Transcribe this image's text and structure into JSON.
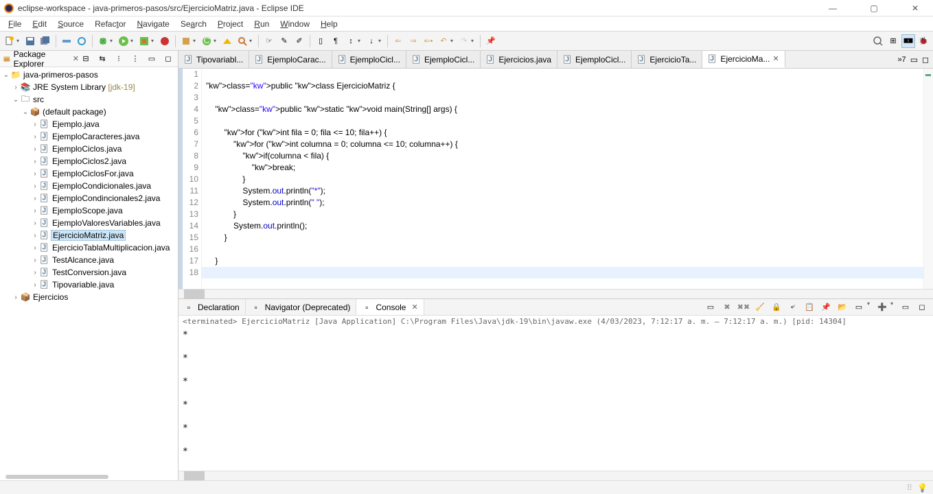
{
  "titlebar": {
    "text": "eclipse-workspace - java-primeros-pasos/src/EjercicioMatriz.java - Eclipse IDE"
  },
  "menu": [
    "File",
    "Edit",
    "Source",
    "Refactor",
    "Navigate",
    "Search",
    "Project",
    "Run",
    "Window",
    "Help"
  ],
  "package_explorer": {
    "title": "Package Explorer",
    "project": "java-primeros-pasos",
    "jre": "JRE System Library",
    "jre_ver": "[jdk-19]",
    "src": "src",
    "pkg": "(default package)",
    "files": [
      "Ejemplo.java",
      "EjemploCaracteres.java",
      "EjemploCiclos.java",
      "EjemploCiclos2.java",
      "EjemploCiclosFor.java",
      "EjemploCondicionales.java",
      "EjemploCondincionales2.java",
      "EjemploScope.java",
      "EjemploValoresVariables.java",
      "EjercicioMatriz.java",
      "EjercicioTablaMultiplicacion.java",
      "TestAlcance.java",
      "TestConversion.java",
      "Tipovariable.java"
    ],
    "selected_index": 9,
    "other_proj": "Ejercicios"
  },
  "editor_tabs": [
    {
      "label": "Tipovariabl...",
      "active": false
    },
    {
      "label": "EjemploCarac...",
      "active": false
    },
    {
      "label": "EjemploCicl...",
      "active": false
    },
    {
      "label": "EjemploCicl...",
      "active": false
    },
    {
      "label": "Ejercicios.java",
      "active": false
    },
    {
      "label": "EjemploCicl...",
      "active": false
    },
    {
      "label": "EjercicioTa...",
      "active": false
    },
    {
      "label": "EjercicioMa...",
      "active": true
    }
  ],
  "tabs_overflow": "»7",
  "code": {
    "lines": [
      "",
      "public class EjercicioMatriz {",
      "",
      "    public static void main(String[] args) {",
      "",
      "        for (int fila = 0; fila <= 10; fila++) {",
      "            for (int columna = 0; columna <= 10; columna++) {",
      "                if(columna < fila) {",
      "                    break;",
      "                }",
      "                System.out.println(\"*\");",
      "                System.out.println(\" \");",
      "            }",
      "            System.out.println();",
      "        }",
      "",
      "    }",
      "}"
    ],
    "highlight_line": 18
  },
  "bottom": {
    "tabs": [
      {
        "label": "Declaration"
      },
      {
        "label": "Navigator (Deprecated)"
      },
      {
        "label": "Console",
        "active": true
      }
    ],
    "status": "<terminated> EjercicioMatriz [Java Application] C:\\Program Files\\Java\\jdk-19\\bin\\javaw.exe (4/03/2023, 7:12:17 a. m. – 7:12:17 a. m.) [pid: 14304]",
    "output": "*\n\n*\n\n*\n\n*\n\n*\n\n*"
  }
}
